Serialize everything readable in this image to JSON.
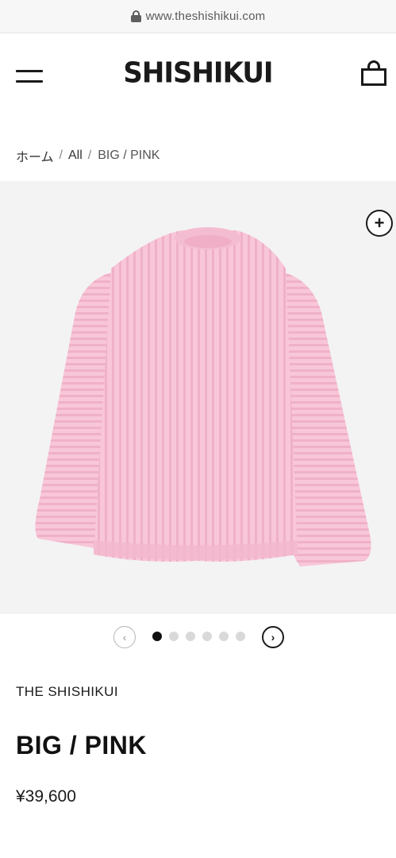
{
  "browser": {
    "url": "www.theshishikui.com"
  },
  "header": {
    "logo": "SHISHIKUI"
  },
  "breadcrumb": {
    "home": "ホーム",
    "sep1": "/",
    "all": "All",
    "sep2": "/",
    "current": "BIG / PINK"
  },
  "gallery": {
    "zoom_label": "+",
    "prev_label": "‹",
    "next_label": "›",
    "slide_count": 6,
    "active_index": 0
  },
  "product": {
    "brand": "THE SHISHIKUI",
    "title": "BIG / PINK",
    "price": "¥39,600",
    "color": "#f7c3d6"
  },
  "colors": {
    "accent": "#1a1a1a",
    "sweater_pink": "#f7c3d6",
    "rib_shadow": "#eaa9c1"
  }
}
